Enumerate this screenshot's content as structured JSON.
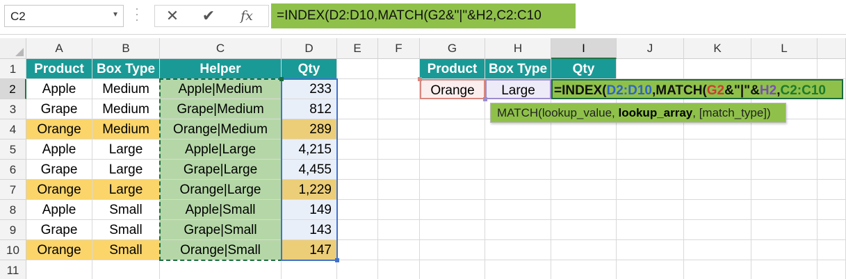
{
  "formula_bar": {
    "name_box": "C2",
    "cancel_icon": "x-icon",
    "enter_icon": "check-icon",
    "fx_label": "fx",
    "formula": "=INDEX(D2:D10,MATCH(G2&\"|\"&H2,C2:C10"
  },
  "columns": [
    "A",
    "B",
    "C",
    "D",
    "E",
    "F",
    "G",
    "H",
    "I",
    "J",
    "K",
    "L"
  ],
  "active_column": "I",
  "rows": [
    "1",
    "2",
    "3",
    "4",
    "5",
    "6",
    "7",
    "8",
    "9",
    "10",
    "11"
  ],
  "active_row": "2",
  "table": {
    "headers": [
      "Product",
      "Box Type",
      "Helper",
      "Qty"
    ],
    "rows": [
      {
        "product": "Apple",
        "box": "Medium",
        "helper": "Apple|Medium",
        "qty": "233",
        "highlight": false
      },
      {
        "product": "Grape",
        "box": "Medium",
        "helper": "Grape|Medium",
        "qty": "812",
        "highlight": false
      },
      {
        "product": "Orange",
        "box": "Medium",
        "helper": "Orange|Medium",
        "qty": "289",
        "highlight": true
      },
      {
        "product": "Apple",
        "box": "Large",
        "helper": "Apple|Large",
        "qty": "4,215",
        "highlight": false
      },
      {
        "product": "Grape",
        "box": "Large",
        "helper": "Grape|Large",
        "qty": "4,455",
        "highlight": false
      },
      {
        "product": "Orange",
        "box": "Large",
        "helper": "Orange|Large",
        "qty": "1,229",
        "highlight": true
      },
      {
        "product": "Apple",
        "box": "Small",
        "helper": "Apple|Small",
        "qty": "149",
        "highlight": false
      },
      {
        "product": "Grape",
        "box": "Small",
        "helper": "Grape|Small",
        "qty": "143",
        "highlight": false
      },
      {
        "product": "Orange",
        "box": "Small",
        "helper": "Orange|Small",
        "qty": "147",
        "highlight": true
      }
    ]
  },
  "lookup": {
    "headers": [
      "Product",
      "Box Type",
      "Qty"
    ],
    "product": "Orange",
    "box_type": "Large",
    "formula_parts": {
      "p1": "=INDEX(",
      "p2": "D2:D10",
      "p3": ",MATCH(",
      "p4": "G2",
      "p5": "&\"|\"&",
      "p6": "H2",
      "p7": ",",
      "p8": "C2:C10"
    }
  },
  "tooltip": {
    "fn": "MATCH(lookup_value, ",
    "bold_arg": "lookup_array",
    "rest": ", [match_type])"
  },
  "colors": {
    "header_teal": "#1a9a96",
    "orange_fill": "#fbd56a",
    "helper_green": "#b5d7a7",
    "formula_green": "#8fc14a",
    "excel_green": "#217346"
  }
}
